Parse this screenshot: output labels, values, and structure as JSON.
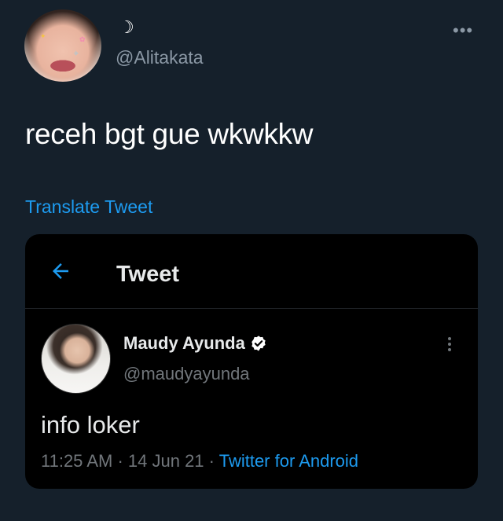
{
  "tweet": {
    "display_name": "☽",
    "handle": "@Alitakata",
    "more_icon": "•••",
    "text": "receh bgt gue wkwkkw",
    "translate_label": "Translate Tweet"
  },
  "quoted": {
    "header_title": "Tweet",
    "author_name": "Maudy Ayunda",
    "author_handle": "@maudyayunda",
    "text": "info loker",
    "time": "11:25 AM",
    "separator": "·",
    "date": "14 Jun 21",
    "source": "Twitter for Android"
  },
  "colors": {
    "background": "#15202b",
    "card_background": "#000000",
    "accent": "#1d9bf0",
    "secondary_text": "#8b98a5"
  },
  "icons": {
    "back": "back-arrow-icon",
    "verified": "verified-badge-icon",
    "more": "more-horizontal-icon",
    "kebab": "more-vertical-icon"
  }
}
